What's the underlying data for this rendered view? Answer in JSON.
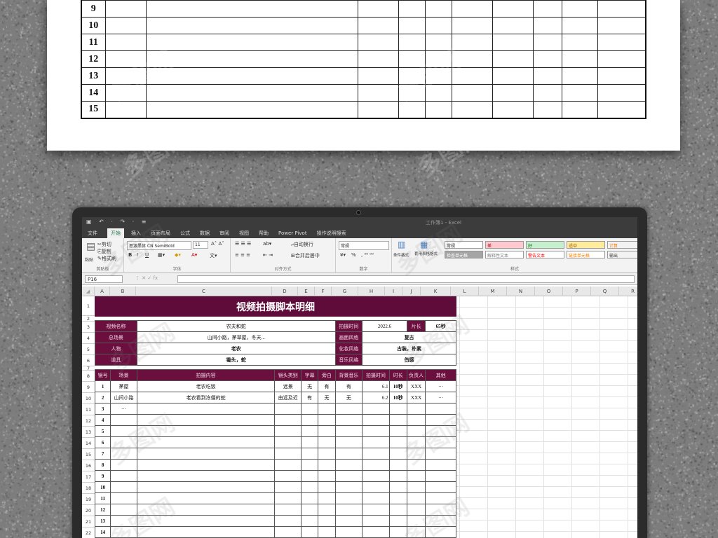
{
  "paper_table": {
    "rows": [
      "9",
      "10",
      "11",
      "12",
      "13",
      "14",
      "15"
    ],
    "column_count": 13
  },
  "app": {
    "quick_access": "▣ ↶ · ↷ · ≡",
    "window_title": "工作簿1 - Excel"
  },
  "menu": [
    "文件",
    "开始",
    "插入",
    "页面布局",
    "公式",
    "数据",
    "审阅",
    "视图",
    "帮助",
    "Power Pivot",
    "操作说明搜索"
  ],
  "menu_active_index": 1,
  "ribbon": {
    "clipboard": {
      "cut": "剪切",
      "copy": "复制",
      "painter": "格式刷",
      "paste": "粘贴",
      "group": "剪贴板"
    },
    "font": {
      "name": "思源黑体 CN SemiBold",
      "size": "11",
      "bold": "B",
      "italic": "I",
      "underline": "U",
      "group": "字体"
    },
    "align": {
      "wrap": "自动换行",
      "merge": "合并后居中",
      "group": "对齐方式"
    },
    "number": {
      "format": "常规",
      "group": "数字",
      "percent": "%"
    },
    "styles_group": "样式",
    "cond_format": "条件格式",
    "table_format": "套用表格格式",
    "cell_styles": [
      {
        "label": "常规",
        "bg": "#ffffff",
        "fg": "#222222"
      },
      {
        "label": "差",
        "bg": "#ffc7ce",
        "fg": "#9c0006"
      },
      {
        "label": "好",
        "bg": "#c6efce",
        "fg": "#006100"
      },
      {
        "label": "适中",
        "bg": "#ffeb9c",
        "fg": "#9c5700"
      },
      {
        "label": "计算",
        "bg": "#f2f2f2",
        "fg": "#fa7d00"
      },
      {
        "label": "检查单元格",
        "bg": "#a5a5a5",
        "fg": "#ffffff"
      },
      {
        "label": "解释性文本",
        "bg": "#ffffff",
        "fg": "#7f7f7f"
      },
      {
        "label": "警告文本",
        "bg": "#ffffff",
        "fg": "#ff0000"
      },
      {
        "label": "链接单元格",
        "bg": "#ffffff",
        "fg": "#fa7d00"
      },
      {
        "label": "输出",
        "bg": "#f2f2f2",
        "fg": "#3f3f3f"
      }
    ]
  },
  "formula_bar": {
    "name_box": "P16",
    "icons": "⋮  ✕  ✓  fx",
    "value": ""
  },
  "columns": [
    "A",
    "B",
    "C",
    "D",
    "E",
    "F",
    "G",
    "H",
    "I",
    "J",
    "K",
    "L",
    "M",
    "N",
    "O",
    "P",
    "Q",
    "R"
  ],
  "row_numbers": [
    "1",
    "2",
    "3",
    "4",
    "5",
    "6",
    "7",
    "8",
    "9",
    "10",
    "11",
    "12",
    "13",
    "14",
    "15",
    "16",
    "17",
    "18",
    "19",
    "20",
    "21",
    "22"
  ],
  "sheet": {
    "title": "视频拍摄脚本明细",
    "info": {
      "video_name_label": "视频名称",
      "video_name": "农夫和蛇",
      "shoot_time_label": "拍摄时间",
      "shoot_time": "2022.6",
      "length_label": "片长",
      "length": "65秒",
      "location_label": "总场景",
      "location": "山间小路，茅草屋，冬天...",
      "style_label": "画面风格",
      "style": "复古",
      "character_label": "人物",
      "character": "老农",
      "makeup_label": "化妆风格",
      "makeup": "古装，朴素",
      "props_label": "道具",
      "props": "锄头，蛇",
      "music_label": "音乐风格",
      "music": "伤感"
    },
    "headers": [
      "镜号",
      "场景",
      "拍摄内容",
      "镜头类别",
      "字幕",
      "旁白",
      "背景音乐",
      "拍摄时间",
      "时长",
      "负责人",
      "其他"
    ],
    "rows": [
      [
        "1",
        "茅屋",
        "老农吃饭",
        "远景",
        "无",
        "有",
        "有",
        "6.1",
        "10秒",
        "XXX",
        "···"
      ],
      [
        "2",
        "山间小路",
        "老农看到冻僵的蛇",
        "由远及近",
        "有",
        "无",
        "无",
        "6.2",
        "10秒",
        "XXX",
        "···"
      ],
      [
        "3",
        "···",
        "",
        "",
        "",
        "",
        "",
        "",
        "",
        "",
        ""
      ],
      [
        "4",
        "",
        "",
        "",
        "",
        "",
        "",
        "",
        "",
        "",
        ""
      ],
      [
        "5",
        "",
        "",
        "",
        "",
        "",
        "",
        "",
        "",
        "",
        ""
      ],
      [
        "6",
        "",
        "",
        "",
        "",
        "",
        "",
        "",
        "",
        "",
        ""
      ],
      [
        "7",
        "",
        "",
        "",
        "",
        "",
        "",
        "",
        "",
        "",
        ""
      ],
      [
        "8",
        "",
        "",
        "",
        "",
        "",
        "",
        "",
        "",
        "",
        ""
      ],
      [
        "9",
        "",
        "",
        "",
        "",
        "",
        "",
        "",
        "",
        "",
        ""
      ],
      [
        "10",
        "",
        "",
        "",
        "",
        "",
        "",
        "",
        "",
        "",
        ""
      ],
      [
        "11",
        "",
        "",
        "",
        "",
        "",
        "",
        "",
        "",
        "",
        ""
      ],
      [
        "12",
        "",
        "",
        "",
        "",
        "",
        "",
        "",
        "",
        "",
        ""
      ],
      [
        "13",
        "",
        "",
        "",
        "",
        "",
        "",
        "",
        "",
        "",
        ""
      ],
      [
        "14",
        "",
        "",
        "",
        "",
        "",
        "",
        "",
        "",
        "",
        ""
      ]
    ]
  },
  "watermark": "多图网"
}
